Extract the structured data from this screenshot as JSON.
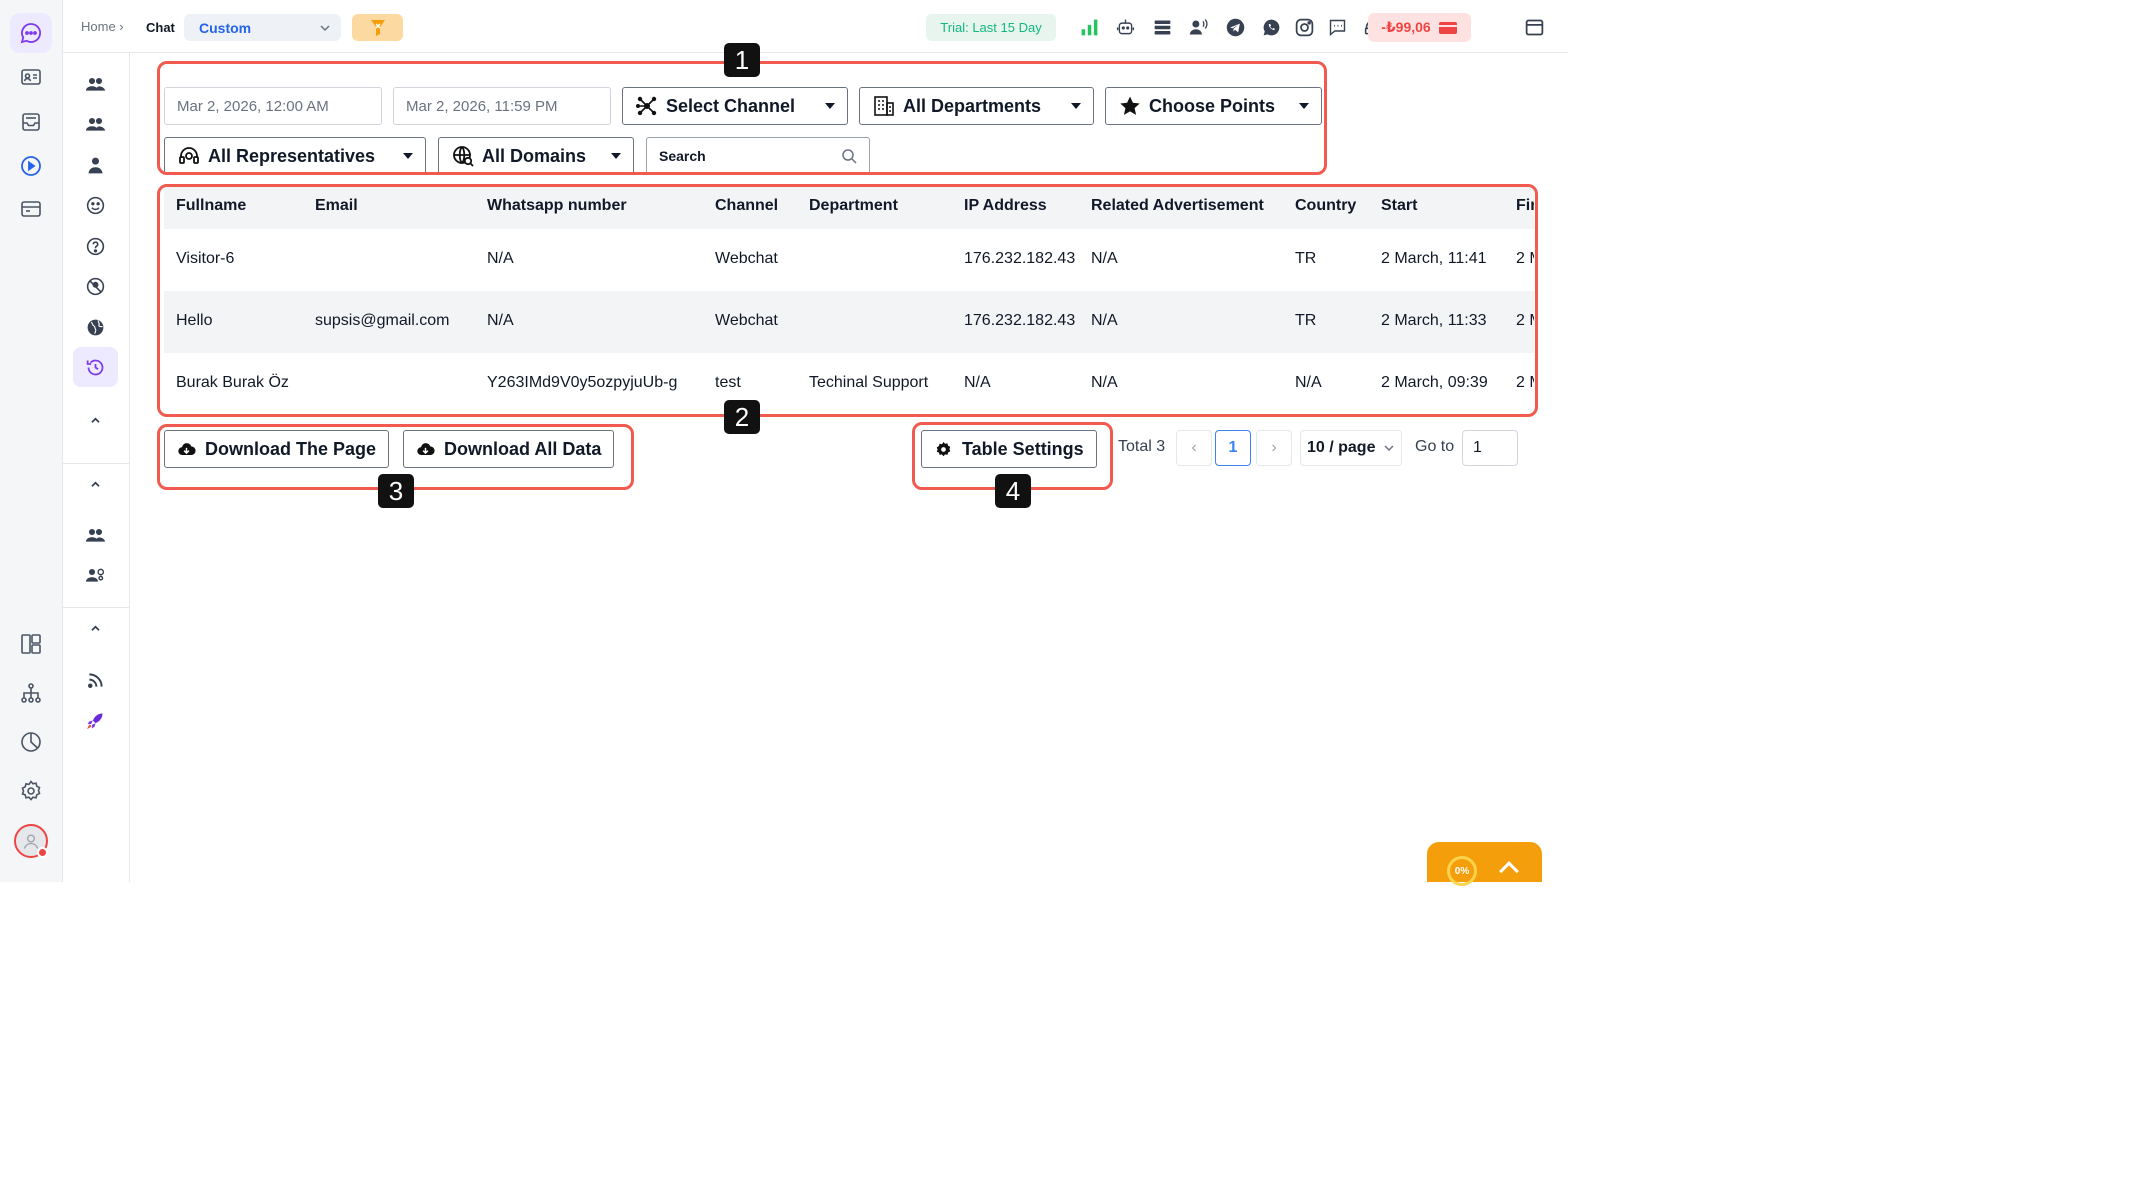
{
  "breadcrumb": {
    "home": "Home ›",
    "current": "Chat"
  },
  "header": {
    "view_select": "Custom",
    "trial_label": "Trial: Last 15 Day",
    "balance": "-₺99,06"
  },
  "filters": {
    "start_date": "Mar 2, 2026, 12:00 AM",
    "end_date": "Mar 2, 2026, 11:59 PM",
    "channel": "Select Channel",
    "departments": "All Departments",
    "points": "Choose Points",
    "representatives": "All Representatives",
    "domains": "All Domains",
    "search_placeholder": "Search"
  },
  "table": {
    "columns": [
      "Fullname",
      "Email",
      "Whatsapp number",
      "Channel",
      "Department",
      "IP Address",
      "Related Advertisement",
      "Country",
      "Start",
      "Fir"
    ],
    "rows": [
      {
        "fullname": "Visitor-6",
        "email": "",
        "whatsapp": "N/A",
        "channel": "Webchat",
        "department": "",
        "ip": "176.232.182.43",
        "ad": "N/A",
        "country": "TR",
        "start": "2 March, 11:41",
        "first": "2 M"
      },
      {
        "fullname": "Hello",
        "email": "supsis@gmail.com",
        "whatsapp": "N/A",
        "channel": "Webchat",
        "department": "",
        "ip": "176.232.182.43",
        "ad": "N/A",
        "country": "TR",
        "start": "2 March, 11:33",
        "first": "2 M"
      },
      {
        "fullname": "Burak Burak Öz",
        "email": "",
        "whatsapp": "Y263IMd9V0y5ozpyjuUb-g",
        "channel": "test",
        "department": "Techinal Support",
        "ip": "N/A",
        "ad": "N/A",
        "country": "N/A",
        "start": "2 March, 09:39",
        "first": "2 M"
      }
    ]
  },
  "actions": {
    "download_page": "Download The Page",
    "download_all": "Download All Data",
    "table_settings": "Table Settings"
  },
  "pagination": {
    "total": "Total 3",
    "prev": "‹",
    "current_page": "1",
    "next": "›",
    "per_page": "10 / page",
    "goto_label": "Go to",
    "goto_value": "1"
  },
  "callouts": [
    "1",
    "2",
    "3",
    "4"
  ],
  "widget": {
    "progress": "0%"
  },
  "colors": {
    "accent": "#7c3aed",
    "callout": "#f05a4f",
    "link": "#2563eb",
    "success": "#10b981",
    "danger": "#ef4444",
    "widget": "#f59e0b"
  }
}
